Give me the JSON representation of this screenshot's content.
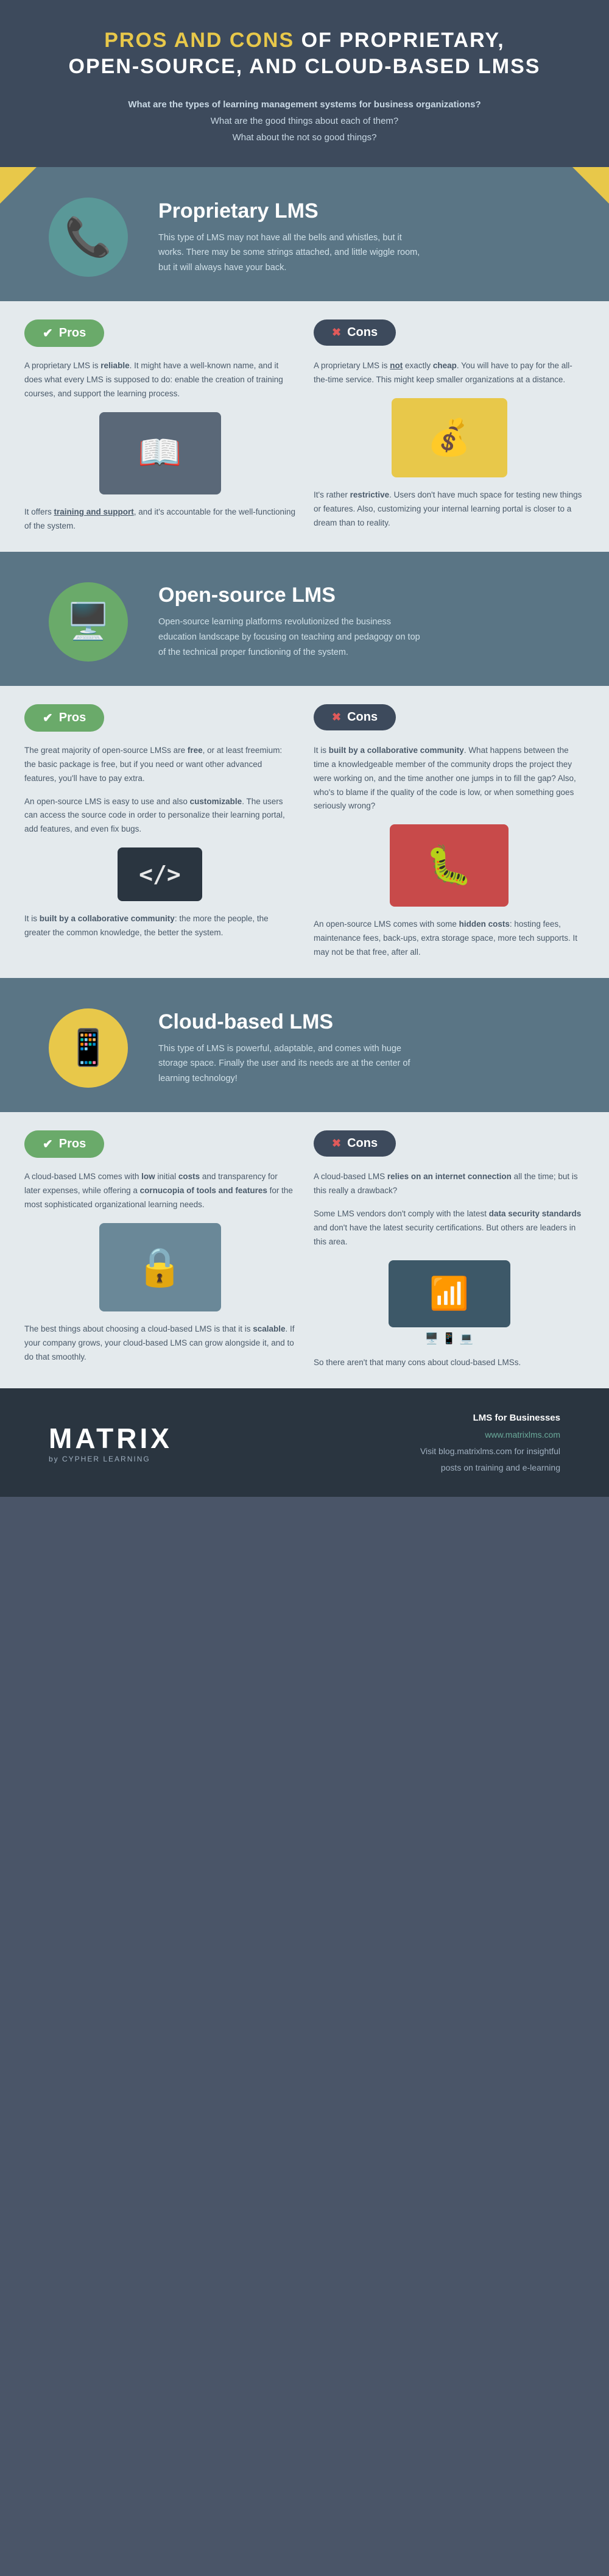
{
  "header": {
    "title_start": "PROS AND CONS",
    "title_rest": " OF PROPRIETARY,\nOPEN-SOURCE, AND CLOUD-BASED LMSs",
    "subtitle_line1": "What are the types of learning management systems for business organizations?",
    "subtitle_line2": "What are the good things about each of them?",
    "subtitle_line3": "What about the not so good things?"
  },
  "proprietary": {
    "title": "Proprietary LMS",
    "description": "This type of LMS may not have all the bells and whistles, but it works. There may be some strings attached, and little wiggle room, but it will always have your back.",
    "pros_label": "Pros",
    "cons_label": "Cons",
    "pro1": "A proprietary LMS is reliable. It might have a well-known name, and it does what every LMS is supposed to do: enable the creation of training courses, and support the learning process.",
    "pro2": "It offers training and support, and it's accountable for the well-functioning of the system.",
    "con1": "A proprietary LMS is not exactly cheap. You will have to pay for the all-the-time service. This might keep smaller organizations at a distance.",
    "con2": "It's rather restrictive. Users don't have much space for testing new things or features. Also, customizing your internal learning portal is closer to a dream than to reality."
  },
  "opensource": {
    "title": "Open-source LMS",
    "description": "Open-source learning platforms revolutionized the business education landscape by focusing on teaching and pedagogy on top of the technical proper functioning of the system.",
    "pros_label": "Pros",
    "cons_label": "Cons",
    "pro1": "The great majority of open-source LMSs are free, or at least freemium: the basic package is free, but if you need or want other advanced features, you'll have to pay extra.",
    "pro2": "An open-source LMS is easy to use and also customizable. The users can access the source code in order to personalize their learning portal, add features, and even fix bugs.",
    "pro3": "It is built by a collaborative community: the more the people, the greater the common knowledge, the better the system.",
    "con1": "It is built by a collaborative community. What happens between the time a knowledgeable member of the community drops the project they were working on, and the time another one jumps in to fill the gap? Also, who's to blame if the quality of the code is low, or when something goes seriously wrong?",
    "con2": "An open-source LMS comes with some hidden costs: hosting fees, maintenance fees, back-ups, extra storage space, more tech supports. It may not be that free, after all."
  },
  "cloudbased": {
    "title": "Cloud-based LMS",
    "description": "This type of LMS is powerful, adaptable, and comes with huge storage space. Finally the user and its needs are at the center of learning technology!",
    "pros_label": "Pros",
    "cons_label": "Cons",
    "pro1": "A cloud-based LMS comes with low initial costs and transparency for later expenses, while offering a cornucopia of tools and features for the most sophisticated organizational learning needs.",
    "pro2": "The best things about choosing a cloud-based LMS is that it is scalable. If your company grows, your cloud-based LMS can grow alongside it, and to do that smoothly.",
    "con1": "A cloud-based LMS relies on an internet connection all the time; but is this really a drawback?",
    "con2": "Some LMS vendors don't comply with the latest data security standards and don't have the latest security certifications. But others are leaders in this area.",
    "con3": "So there aren't that many cons about cloud-based LMSs."
  },
  "footer": {
    "logo": "MATRIX",
    "byline": "by CYPHER LEARNING",
    "right_label": "LMS for Businesses",
    "url": "www.matrixlms.com",
    "blog_text": "Visit blog.matrixlms.com for insightful",
    "blog_text2": "posts on training and e-learning"
  }
}
